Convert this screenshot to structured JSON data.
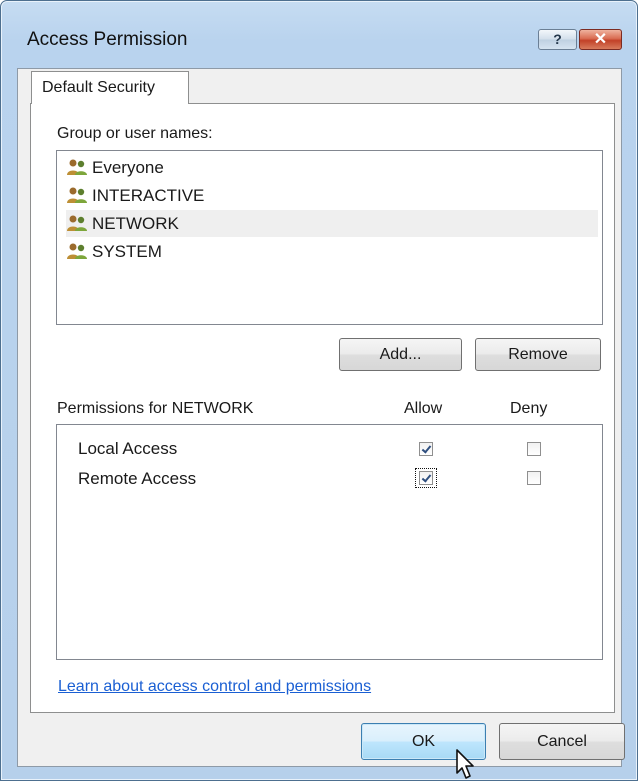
{
  "window": {
    "title": "Access Permission",
    "help_symbol": "?",
    "close_symbol": "✕"
  },
  "tabs": [
    {
      "label": "Default Security",
      "active": true
    }
  ],
  "groups": {
    "label": "Group or user names:",
    "items": [
      {
        "name": "Everyone",
        "icon": "users-icon",
        "selected": false
      },
      {
        "name": "INTERACTIVE",
        "icon": "users-icon",
        "selected": false
      },
      {
        "name": "NETWORK",
        "icon": "users-icon",
        "selected": true
      },
      {
        "name": "SYSTEM",
        "icon": "users-icon",
        "selected": false
      }
    ],
    "add_button": "Add...",
    "remove_button": "Remove"
  },
  "permissions": {
    "label": "Permissions for NETWORK",
    "allow_header": "Allow",
    "deny_header": "Deny",
    "items": [
      {
        "name": "Local Access",
        "allow": true,
        "deny": false
      },
      {
        "name": "Remote Access",
        "allow": true,
        "deny": false,
        "focused": true
      }
    ]
  },
  "help_link": "Learn about access control and permissions",
  "buttons": {
    "ok": "OK",
    "cancel": "Cancel"
  },
  "colors": {
    "titlebar": "#c6dcf2",
    "link": "#1a5fd3",
    "close_button": "#c24128",
    "selected_row": "#efefef"
  }
}
